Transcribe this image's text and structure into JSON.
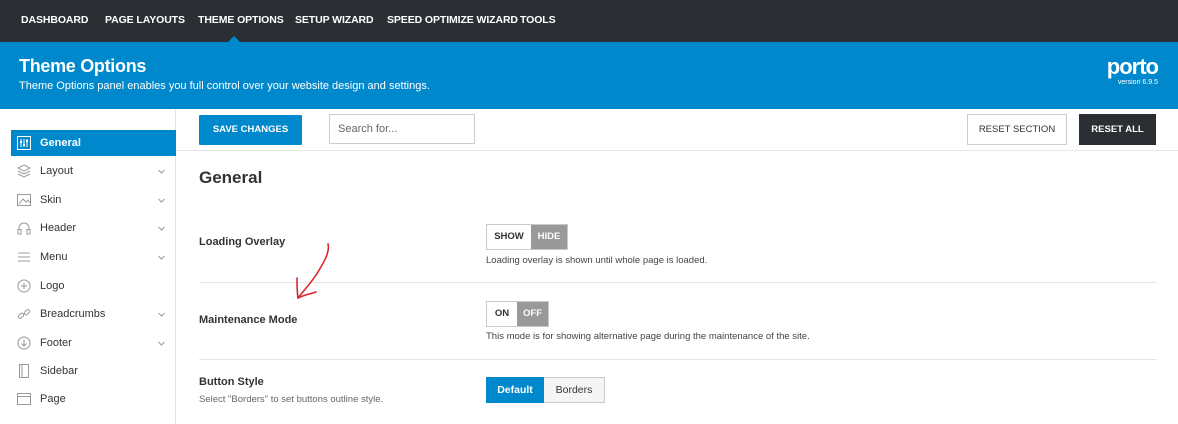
{
  "topnav": {
    "items": [
      {
        "label": "DASHBOARD"
      },
      {
        "label": "PAGE LAYOUTS"
      },
      {
        "label": "THEME OPTIONS"
      },
      {
        "label": "SETUP WIZARD"
      },
      {
        "label": "SPEED OPTIMIZE WIZARD"
      },
      {
        "label": "TOOLS"
      }
    ],
    "active": "THEME OPTIONS"
  },
  "header": {
    "title": "Theme Options",
    "subtitle": "Theme Options panel enables you full control over your website design and settings.",
    "logo_text": "porto",
    "version": "version 6.9.5"
  },
  "toolbar": {
    "save_label": "SAVE CHANGES",
    "search_placeholder": "Search for...",
    "reset_section_label": "RESET SECTION",
    "reset_all_label": "RESET ALL"
  },
  "sidebar": {
    "items": [
      {
        "label": "General",
        "icon": "sliders-icon",
        "active": true,
        "chevron": false
      },
      {
        "label": "Layout",
        "icon": "layers-icon",
        "active": false,
        "chevron": true
      },
      {
        "label": "Skin",
        "icon": "image-icon",
        "active": false,
        "chevron": true
      },
      {
        "label": "Header",
        "icon": "headphones-icon",
        "active": false,
        "chevron": true
      },
      {
        "label": "Menu",
        "icon": "menu-icon",
        "active": false,
        "chevron": true
      },
      {
        "label": "Logo",
        "icon": "plus-circle-icon",
        "active": false,
        "chevron": false
      },
      {
        "label": "Breadcrumbs",
        "icon": "link-icon",
        "active": false,
        "chevron": true
      },
      {
        "label": "Footer",
        "icon": "arrow-down-circle-icon",
        "active": false,
        "chevron": true
      },
      {
        "label": "Sidebar",
        "icon": "sidebar-icon",
        "active": false,
        "chevron": false
      },
      {
        "label": "Page",
        "icon": "page-icon",
        "active": false,
        "chevron": false
      }
    ]
  },
  "content": {
    "section_title": "General",
    "loading_overlay": {
      "label": "Loading Overlay",
      "options": [
        "SHOW",
        "HIDE"
      ],
      "selected": "HIDE",
      "description": "Loading overlay is shown until whole page is loaded."
    },
    "maintenance_mode": {
      "label": "Maintenance Mode",
      "options": [
        "ON",
        "OFF"
      ],
      "selected": "OFF",
      "description": "This mode is for showing alternative page during the maintenance of the site."
    },
    "button_style": {
      "label": "Button Style",
      "sublabel": "Select \"Borders\" to set buttons outline style.",
      "options": [
        "Default",
        "Borders"
      ],
      "selected": "Default"
    }
  },
  "colors": {
    "accent": "#0088cc",
    "topbar": "#2b2f33",
    "annotation": "#d9262b"
  }
}
